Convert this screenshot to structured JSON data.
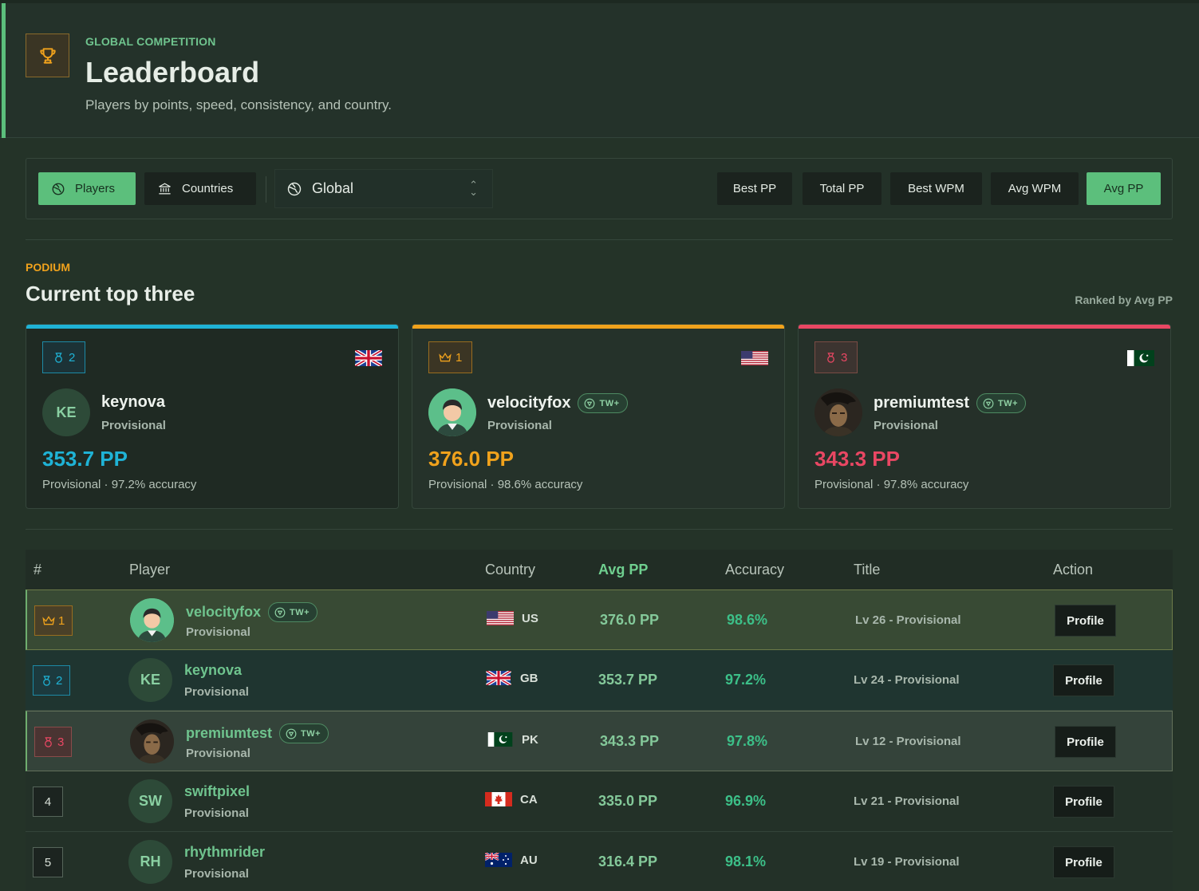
{
  "header": {
    "eyebrow": "GLOBAL COMPETITION",
    "title": "Leaderboard",
    "subtitle": "Players by points, speed, consistency, and country.",
    "icon": "trophy-icon"
  },
  "toolbar": {
    "view_tabs": [
      {
        "label": "Players",
        "icon": "globe-icon",
        "active": true
      },
      {
        "label": "Countries",
        "icon": "bank-icon",
        "active": false
      }
    ],
    "region_select": {
      "value": "Global",
      "icon": "globe-icon"
    },
    "sort_buttons": [
      {
        "label": "Best PP",
        "active": false
      },
      {
        "label": "Total PP",
        "active": false
      },
      {
        "label": "Best WPM",
        "active": false
      },
      {
        "label": "Avg WPM",
        "active": false
      },
      {
        "label": "Avg PP",
        "active": true
      }
    ]
  },
  "podium": {
    "eyebrow": "PODIUM",
    "title": "Current top three",
    "ranked_by": "Ranked by Avg PP",
    "cards": [
      {
        "rank": "2",
        "name": "keynova",
        "initials": "KE",
        "status": "Provisional",
        "pp": "353.7 PP",
        "meta": "Provisional · 97.2% accuracy",
        "country": "GB",
        "color": "#1fb3d6",
        "badge": ""
      },
      {
        "rank": "1",
        "name": "velocityfox",
        "initials": "",
        "status": "Provisional",
        "pp": "376.0 PP",
        "meta": "Provisional · 98.6% accuracy",
        "country": "US",
        "color": "#f0a21c",
        "badge": "TW+"
      },
      {
        "rank": "3",
        "name": "premiumtest",
        "initials": "",
        "status": "Provisional",
        "pp": "343.3 PP",
        "meta": "Provisional · 97.8% accuracy",
        "country": "PK",
        "color": "#e94763",
        "badge": "TW+"
      }
    ]
  },
  "table": {
    "headers": {
      "rank": "#",
      "player": "Player",
      "country": "Country",
      "avg_pp": "Avg PP",
      "accuracy": "Accuracy",
      "title": "Title",
      "action": "Action"
    },
    "rows": [
      {
        "rank": "1",
        "name": "velocityfox",
        "initials": "",
        "status": "Provisional",
        "badge": "TW+",
        "country": "US",
        "avg_pp": "376.0 PP",
        "accuracy": "98.6%",
        "title": "Lv 26 - Provisional",
        "action": "Profile"
      },
      {
        "rank": "2",
        "name": "keynova",
        "initials": "KE",
        "status": "Provisional",
        "badge": "",
        "country": "GB",
        "avg_pp": "353.7 PP",
        "accuracy": "97.2%",
        "title": "Lv 24 - Provisional",
        "action": "Profile"
      },
      {
        "rank": "3",
        "name": "premiumtest",
        "initials": "",
        "status": "Provisional",
        "badge": "TW+",
        "country": "PK",
        "avg_pp": "343.3 PP",
        "accuracy": "97.8%",
        "title": "Lv 12 - Provisional",
        "action": "Profile"
      },
      {
        "rank": "4",
        "name": "swiftpixel",
        "initials": "SW",
        "status": "Provisional",
        "badge": "",
        "country": "CA",
        "avg_pp": "335.0 PP",
        "accuracy": "96.9%",
        "title": "Lv 21 - Provisional",
        "action": "Profile"
      },
      {
        "rank": "5",
        "name": "rhythmrider",
        "initials": "RH",
        "status": "Provisional",
        "badge": "",
        "country": "AU",
        "avg_pp": "316.4 PP",
        "accuracy": "98.1%",
        "title": "Lv 19 - Provisional",
        "action": "Profile"
      }
    ]
  },
  "colors": {
    "accent": "#5cbf7c",
    "gold": "#f0a21c",
    "teal": "#1fb3d6",
    "red": "#e94763"
  }
}
